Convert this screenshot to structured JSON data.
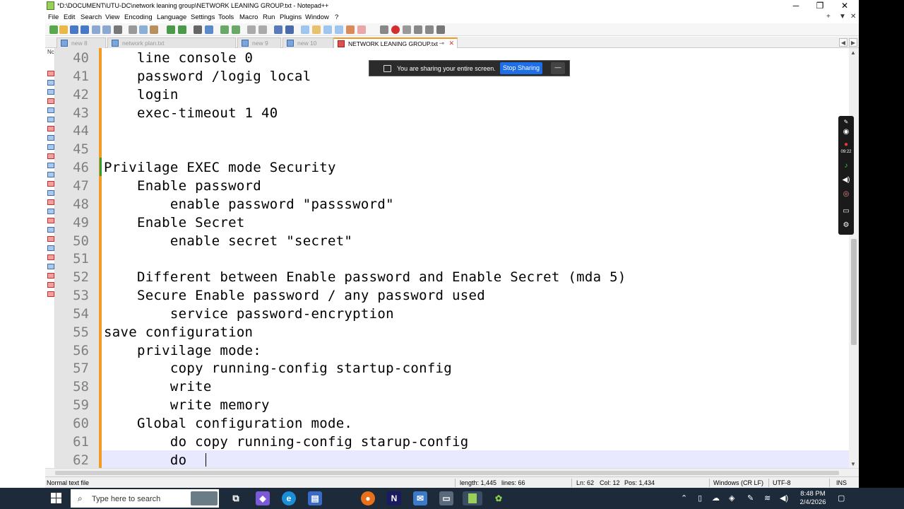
{
  "window": {
    "title": "*D:\\DOCUMENT\\UTU-DC\\network leaning group\\NETWORK LEANING GROUP.txt - Notepad++",
    "minimize": "─",
    "maximize": "❐",
    "close": "✕"
  },
  "menubar": {
    "items": [
      "File",
      "Edit",
      "Search",
      "View",
      "Encoding",
      "Language",
      "Settings",
      "Tools",
      "Macro",
      "Run",
      "Plugins",
      "Window",
      "?"
    ],
    "right": [
      "+",
      "▼",
      "✕"
    ]
  },
  "tabs": [
    {
      "label": "new 8",
      "active": false
    },
    {
      "label": "network plan.txt",
      "active": false
    },
    {
      "label": "new 9",
      "active": false
    },
    {
      "label": "new 10",
      "active": false
    },
    {
      "label": "NETWORK LEANING GROUP.txt",
      "active": true
    }
  ],
  "tab_nav": {
    "left": "◀",
    "right": "▶",
    "close": "✕"
  },
  "docmap_label": "Nc",
  "editor": {
    "lines": [
      {
        "num": "40",
        "text": "    line console 0"
      },
      {
        "num": "41",
        "text": "    password /logig local"
      },
      {
        "num": "42",
        "text": "    login"
      },
      {
        "num": "43",
        "text": "    exec-timeout 1 40"
      },
      {
        "num": "44",
        "text": ""
      },
      {
        "num": "45",
        "text": ""
      },
      {
        "num": "46",
        "text": "Privilage EXEC mode Security"
      },
      {
        "num": "47",
        "text": "    Enable password"
      },
      {
        "num": "48",
        "text": "        enable password \"passsword\""
      },
      {
        "num": "49",
        "text": "    Enable Secret"
      },
      {
        "num": "50",
        "text": "        enable secret \"secret\""
      },
      {
        "num": "51",
        "text": ""
      },
      {
        "num": "52",
        "text": "    Different between Enable password and Enable Secret (mda 5)"
      },
      {
        "num": "53",
        "text": "    Secure Enable password / any password used"
      },
      {
        "num": "54",
        "text": "        service password-encryption"
      },
      {
        "num": "55",
        "text": "save configuration"
      },
      {
        "num": "56",
        "text": "    privilage mode:"
      },
      {
        "num": "57",
        "text": "        copy running-config startup-config"
      },
      {
        "num": "58",
        "text": "        write"
      },
      {
        "num": "59",
        "text": "        write memory"
      },
      {
        "num": "60",
        "text": "    Global configuration mode."
      },
      {
        "num": "61",
        "text": "        do copy running-config starup-config"
      },
      {
        "num": "62",
        "text": "        do "
      }
    ]
  },
  "statusbar": {
    "type": "Normal text file",
    "length": "length: 1,445",
    "lines": "lines: 66",
    "ln": "Ln: 62",
    "col": "Col: 12",
    "pos": "Pos: 1,434",
    "eol": "Windows (CR LF)",
    "encoding": "UTF-8",
    "mode": "INS"
  },
  "share_banner": {
    "text": "You are sharing your entire screen.",
    "stop_label": "Stop Sharing",
    "min_label": "—"
  },
  "recorder": {
    "time": "09:22"
  },
  "taskbar": {
    "search_placeholder": "Type here to search",
    "clock_time": "8:48 PM",
    "clock_date": "2/4/2026",
    "notepad_icon_letter": "N"
  },
  "colors": {
    "accent_orange": "#f29c28",
    "current_line": "#e8e8ff",
    "share_blue": "#1e6ee8",
    "taskbar": "#1c2a3a"
  }
}
